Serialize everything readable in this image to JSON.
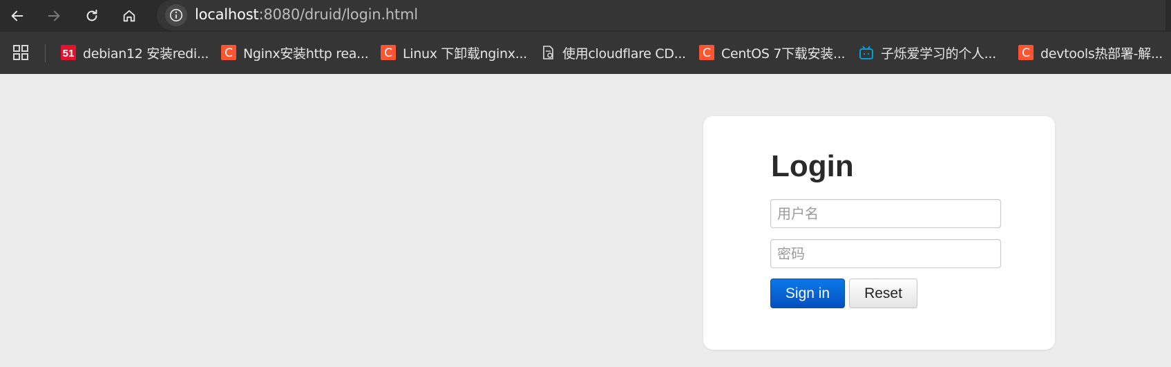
{
  "browser": {
    "url_host": "localhost",
    "url_path": ":8080/druid/login.html",
    "nav_icons": [
      "back-icon",
      "forward-icon",
      "reload-icon",
      "home-icon"
    ]
  },
  "bookmarks": [
    {
      "label": "debian12 安装redi...",
      "icon": "51cto-icon",
      "color": "#e0142e"
    },
    {
      "label": "Nginx安装http rea...",
      "icon": "csdn-icon",
      "color": "#fc5531"
    },
    {
      "label": "Linux 下卸载nginx...",
      "icon": "csdn-icon",
      "color": "#fc5531"
    },
    {
      "label": "使用cloudflare CD...",
      "icon": "document-icon",
      "color": "#e0e0e0"
    },
    {
      "label": "CentOS 7下载安装...",
      "icon": "csdn-icon",
      "color": "#fc5531"
    },
    {
      "label": "子烁爱学习的个人...",
      "icon": "bilibili-icon",
      "color": "#00a1d6"
    },
    {
      "label": "devtools热部署-解...",
      "icon": "csdn-icon",
      "color": "#fc5531"
    }
  ],
  "login": {
    "title": "Login",
    "username_placeholder": "用户名",
    "password_placeholder": "密码",
    "signin_label": "Sign in",
    "reset_label": "Reset"
  }
}
